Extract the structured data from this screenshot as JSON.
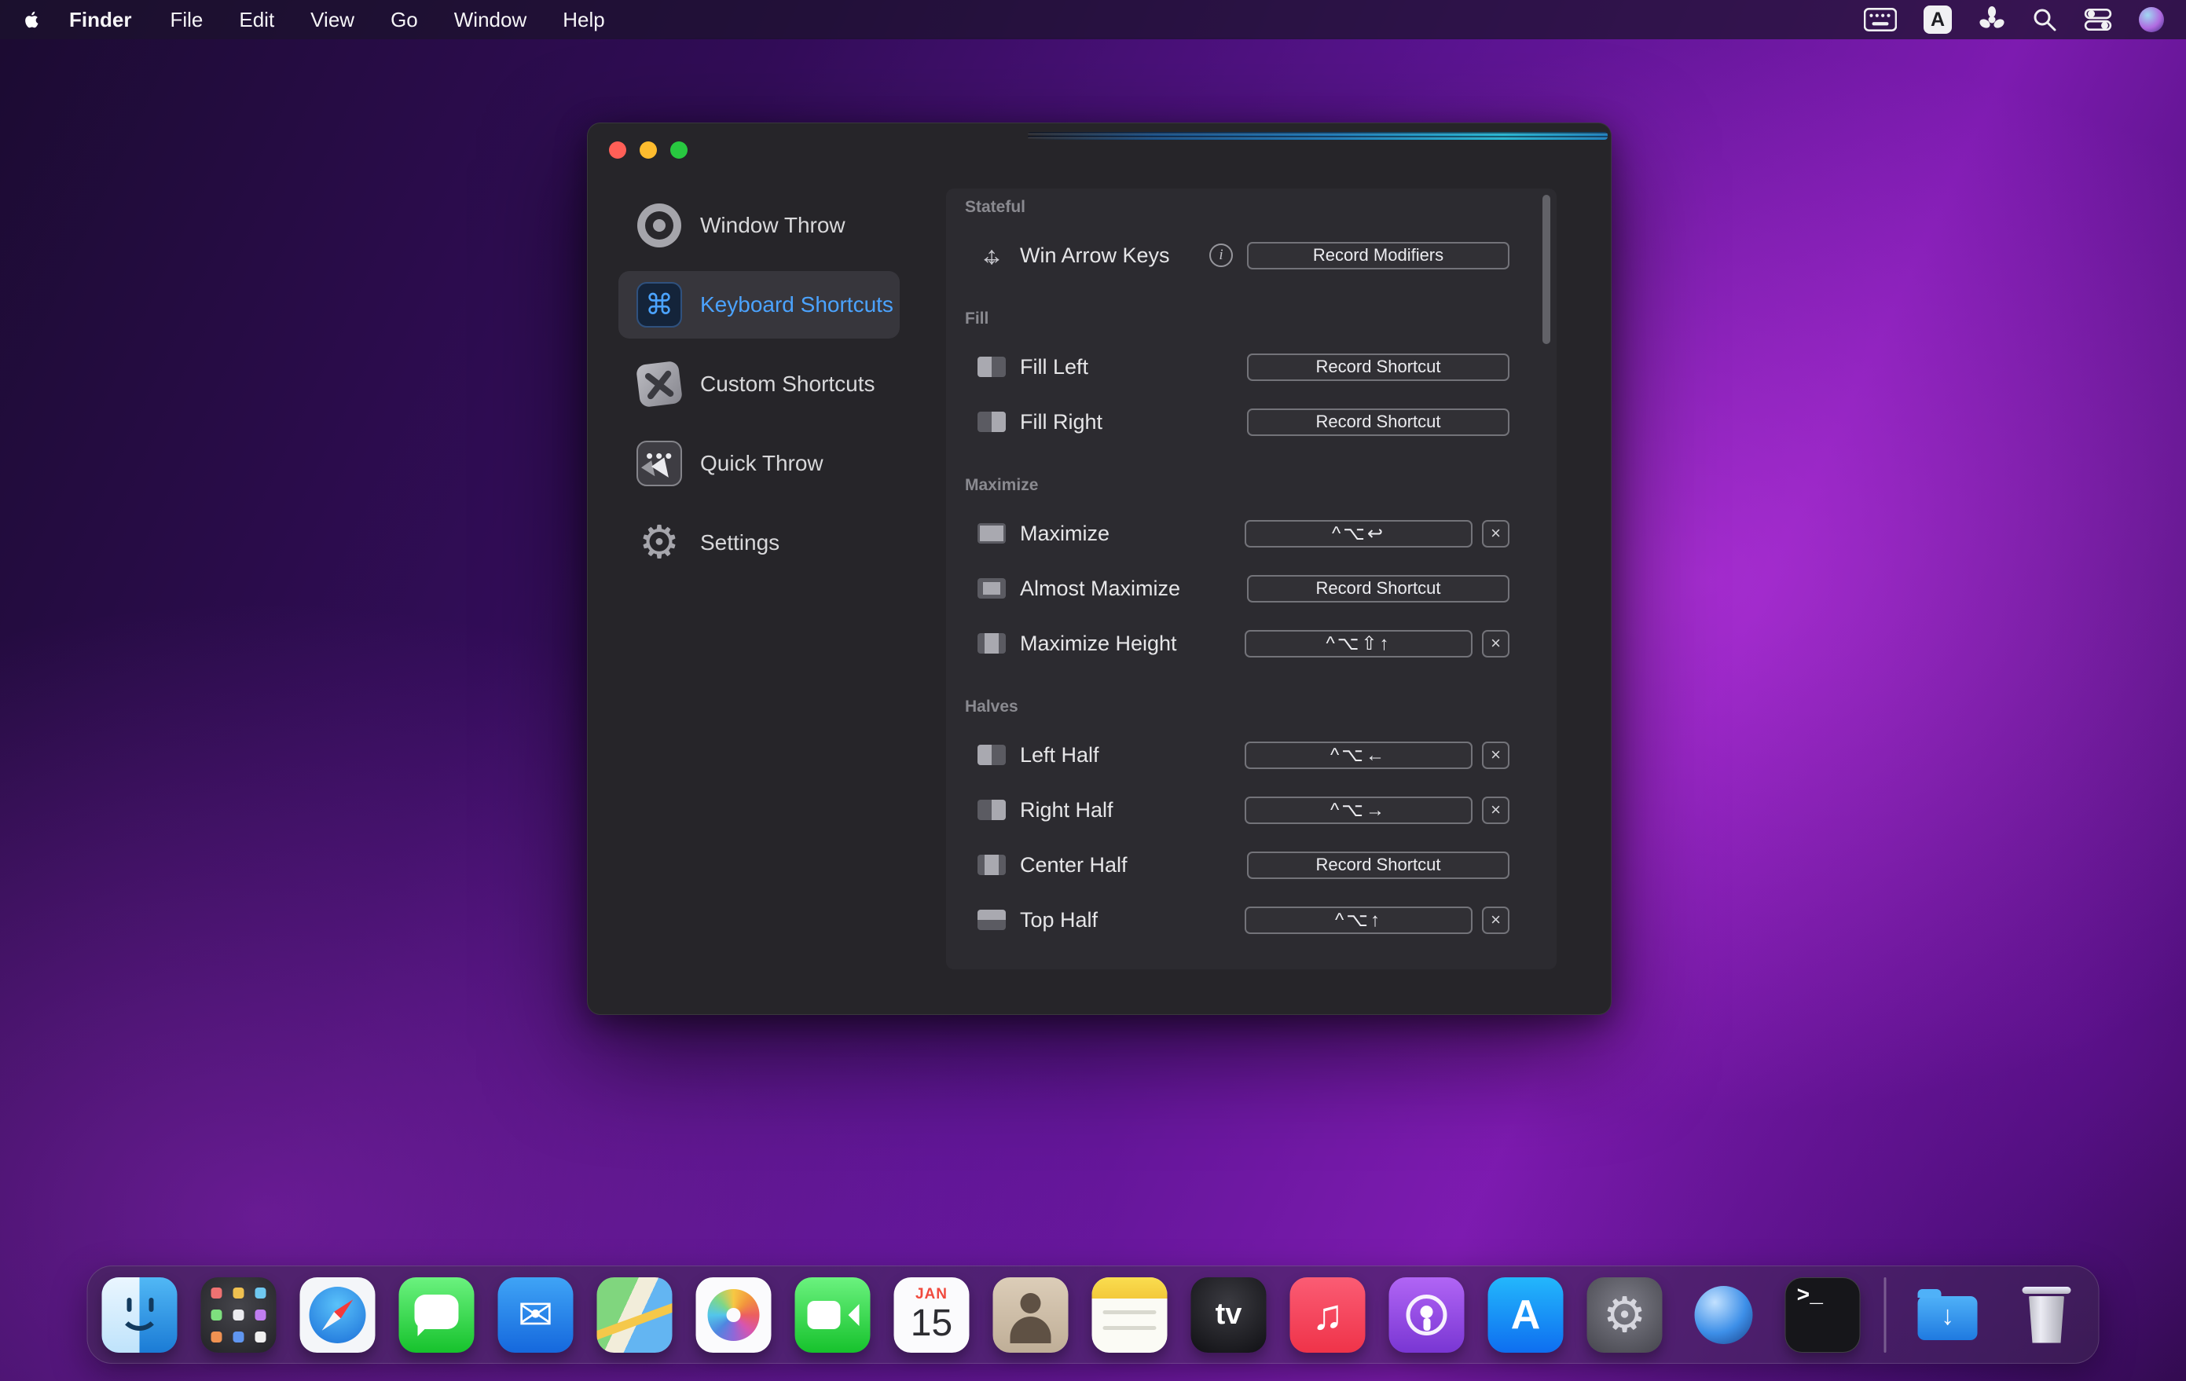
{
  "menu_bar": {
    "app_name": "Finder",
    "menus": [
      "File",
      "Edit",
      "View",
      "Go",
      "Window",
      "Help"
    ],
    "status_icons": [
      "keyboard-icon",
      "input-source-icon",
      "fan-icon",
      "spotlight-search-icon",
      "control-center-icon",
      "siri-icon"
    ]
  },
  "glyphs": {
    "input_a": "A",
    "info": "i",
    "clear": "×",
    "mail_envelope": "✉",
    "music_note": "♫",
    "gear": "⚙",
    "download_arrow": "↓"
  },
  "window": {
    "sidebar": {
      "items": [
        {
          "label": "Window Throw",
          "icon": "window-throw-icon",
          "selected": false
        },
        {
          "label": "Keyboard Shortcuts",
          "icon": "command-key-icon",
          "selected": true
        },
        {
          "label": "Custom Shortcuts",
          "icon": "tools-key-icon",
          "selected": false
        },
        {
          "label": "Quick Throw",
          "icon": "cursor-key-icon",
          "selected": false
        },
        {
          "label": "Settings",
          "icon": "gear-icon",
          "selected": false
        }
      ]
    },
    "panel": {
      "sections": [
        {
          "title": "Stateful",
          "rows": [
            {
              "label": "Win Arrow Keys",
              "icon": "move-icon",
              "has_info": true,
              "button": "Record Modifiers"
            }
          ]
        },
        {
          "title": "Fill",
          "rows": [
            {
              "label": "Fill Left",
              "icon": "fill-left",
              "button": "Record Shortcut"
            },
            {
              "label": "Fill Right",
              "icon": "fill-right",
              "button": "Record Shortcut"
            }
          ]
        },
        {
          "title": "Maximize",
          "rows": [
            {
              "label": "Maximize",
              "icon": "maximize",
              "shortcut": "^⌥↩"
            },
            {
              "label": "Almost Maximize",
              "icon": "almost-maximize",
              "button": "Record Shortcut"
            },
            {
              "label": "Maximize Height",
              "icon": "maximize-height",
              "shortcut": "^⌥⇧↑"
            }
          ]
        },
        {
          "title": "Halves",
          "rows": [
            {
              "label": "Left Half",
              "icon": "left-half",
              "shortcut": "^⌥←"
            },
            {
              "label": "Right Half",
              "icon": "right-half",
              "shortcut": "^⌥→"
            },
            {
              "label": "Center Half",
              "icon": "center-half",
              "button": "Record Shortcut"
            },
            {
              "label": "Top Half",
              "icon": "top-half",
              "shortcut": "^⌥↑"
            }
          ]
        }
      ]
    }
  },
  "dock": {
    "items": [
      "finder",
      "launchpad",
      "safari",
      "messages",
      "mail",
      "maps",
      "photos",
      "facetime",
      "calendar",
      "contacts",
      "notes",
      "apple-tv",
      "music",
      "podcasts",
      "app-store",
      "system-preferences",
      "window-throw-app",
      "terminal",
      "divider",
      "downloads",
      "trash"
    ],
    "calendar": {
      "month": "JAN",
      "day": "15"
    },
    "apple_tv_label": "tv",
    "terminal_prompt": ">_",
    "app_store_letter": "A"
  }
}
